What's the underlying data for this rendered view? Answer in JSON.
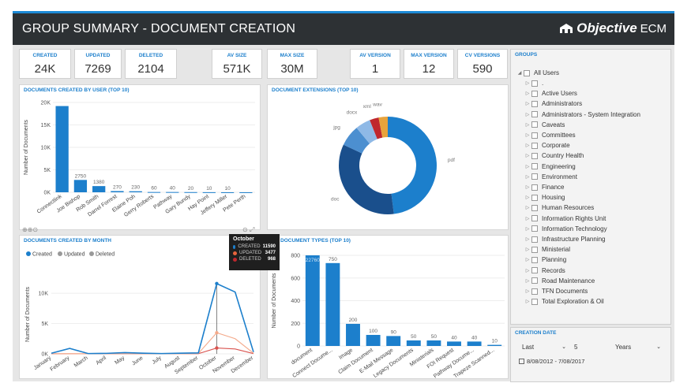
{
  "header": {
    "title": "GROUP SUMMARY - DOCUMENT CREATION",
    "brand": "Objective",
    "brand_suffix": "ECM"
  },
  "kpis": [
    {
      "label": "CREATED",
      "value": "24K"
    },
    {
      "label": "UPDATED",
      "value": "7269"
    },
    {
      "label": "DELETED",
      "value": "2104"
    },
    {
      "label": "AV SIZE",
      "value": "571K"
    },
    {
      "label": "MAX SIZE",
      "value": "30M"
    },
    {
      "label": "AV VERSION",
      "value": "1"
    },
    {
      "label": "MAX VERSION",
      "value": "12"
    },
    {
      "label": "CV VERSIONS",
      "value": "590"
    }
  ],
  "panels": {
    "by_user": "DOCUMENTS CREATED BY USER (TOP 10)",
    "extensions": "DOCUMENT EXTENSIONS (TOP 10)",
    "by_month": "DOCUMENTS CREATED BY MONTH",
    "types": "DOCUMENT TYPES (TOP 10)"
  },
  "groups": {
    "title": "GROUPS",
    "root": "All Users",
    "items": [
      ".",
      "Active Users",
      "Administrators",
      "Administrators - System Integration",
      "Caveats",
      "Committees",
      "Corporate",
      "Country Health",
      "Engineering",
      "Environment",
      "Finance",
      "Housing",
      "Human Resources",
      "Information Rights Unit",
      "Information Technology",
      "Infrastructure Planning",
      "Ministerial",
      "Planning",
      "Records",
      "Road Maintenance",
      "TFN Documents",
      "Total Exploration & Oil"
    ]
  },
  "creation_date": {
    "title": "CREATION DATE",
    "period": "Last",
    "amount": "5",
    "unit": "Years",
    "range": "8/08/2012 - 7/08/2017"
  },
  "tooltip": {
    "title": "October",
    "rows": [
      {
        "label": "CREATED",
        "value": "11590",
        "color": "#1c7fcc"
      },
      {
        "label": "UPDATED",
        "value": "3477",
        "color": "#e8643c"
      },
      {
        "label": "DELETED",
        "value": "968",
        "color": "#c0272d"
      }
    ]
  },
  "colors": {
    "accent": "#1c7fcc",
    "header_bg": "#2d3134",
    "updated": "#f4a98a",
    "deleted": "#d9534f"
  },
  "chart_data": [
    {
      "type": "bar",
      "title": "DOCUMENTS CREATED BY USER (TOP 10)",
      "ylabel": "Number of Documents",
      "categories": [
        "Connectlink",
        "Joe Bishop",
        "Rob Smith",
        "Darrel Forrest",
        "Elaine Poh",
        "Gerry Roberts",
        "Pathway",
        "Gary Bundy",
        "Hay Point",
        "Jeffery Miller",
        "Pete Perth"
      ],
      "values": [
        19200,
        2750,
        1380,
        270,
        230,
        60,
        60,
        40,
        20,
        10,
        10
      ],
      "value_labels": [
        "",
        "2750",
        "1380",
        "270",
        "230",
        "60",
        "40",
        "20",
        "10",
        "10",
        ""
      ],
      "ytick_labels": [
        "0K",
        "5K",
        "10K",
        "15K",
        "20K"
      ],
      "ylim": [
        0,
        20000
      ]
    },
    {
      "type": "pie",
      "title": "DOCUMENT EXTENSIONS (TOP 10)",
      "labels": [
        "pdf",
        "doc",
        "jpg",
        "docx",
        "xml",
        "wav"
      ],
      "values": [
        48,
        34,
        7,
        5,
        3,
        3
      ],
      "colors": [
        "#1c7fcc",
        "#1a4f8c",
        "#4c8fd0",
        "#8fb9e6",
        "#c0272d",
        "#e8a33c"
      ]
    },
    {
      "type": "line",
      "title": "DOCUMENTS CREATED BY MONTH",
      "ylabel": "Number of Documents",
      "categories": [
        "January",
        "February",
        "March",
        "April",
        "May",
        "June",
        "July",
        "August",
        "September",
        "October",
        "November",
        "December"
      ],
      "series": [
        {
          "name": "Created",
          "values": [
            100,
            900,
            50,
            80,
            200,
            100,
            50,
            100,
            150,
            11590,
            10200,
            300
          ],
          "color": "#1c7fcc"
        },
        {
          "name": "Updated",
          "values": [
            20,
            30,
            10,
            20,
            40,
            20,
            10,
            30,
            60,
            3477,
            2500,
            100
          ],
          "color": "#f4a98a"
        },
        {
          "name": "Deleted",
          "values": [
            10,
            15,
            5,
            10,
            20,
            10,
            5,
            15,
            30,
            968,
            800,
            40
          ],
          "color": "#d9534f"
        }
      ],
      "ytick_labels": [
        "0K",
        "5K",
        "10K"
      ],
      "ylim": [
        0,
        13000
      ]
    },
    {
      "type": "bar",
      "title": "DOCUMENT TYPES (TOP 10)",
      "ylabel": "Number of Documents",
      "categories": [
        "document",
        "Connect Docume...",
        "Image",
        "Claim Document",
        "E-Mail Message",
        "Legacy Documents",
        "Ministerials",
        "FOI Request",
        "Pathway Docume...",
        "Trapeze Scanned..."
      ],
      "values": [
        22760,
        750,
        200,
        100,
        90,
        50,
        50,
        40,
        40,
        10
      ],
      "value_labels": [
        "22760",
        "750",
        "200",
        "100",
        "90",
        "50",
        "50",
        "40",
        "40",
        "10"
      ],
      "ytick_labels": [
        "0",
        "200",
        "400",
        "600",
        "800"
      ],
      "ylim": [
        0,
        820
      ]
    }
  ]
}
